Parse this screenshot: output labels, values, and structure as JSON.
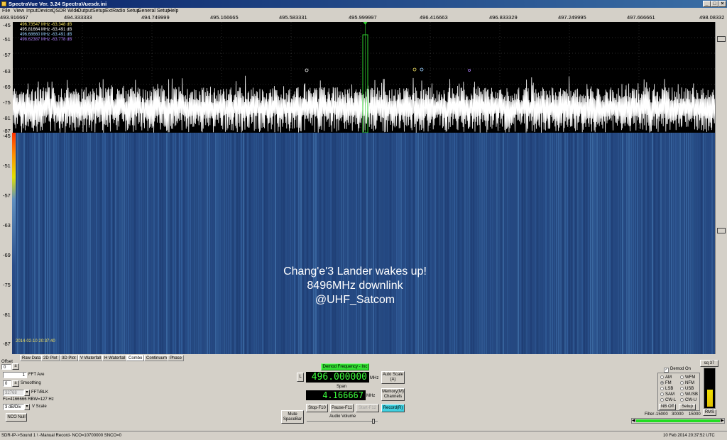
{
  "window": {
    "title": "SpectraVue Ver. 3.24  SpectraVuesdr.ini"
  },
  "menu": [
    "File",
    "View",
    "InputDevice",
    "QSDR Wide",
    "OutputSetup",
    "ExtRadio Setup",
    "General Setup",
    "Help"
  ],
  "spectrum": {
    "freq_ticks": [
      "493.916667",
      "494.333333",
      "494.749999",
      "495.166665",
      "495.583331",
      "495.999997",
      "496.416663",
      "496.833329",
      "497.249995",
      "497.666661",
      "498.08332"
    ],
    "db_ticks": [
      "-45",
      "-51",
      "-57",
      "-63",
      "-69",
      "-75",
      "-81",
      "-87"
    ],
    "markers": [
      {
        "text": "496.73547 MHz  -63.348 dB",
        "color": "#f0e060"
      },
      {
        "text": "495.81664 MHz  -63.491 dB",
        "color": "#ffffff"
      },
      {
        "text": "496.68660 MHz  -63.491 dB",
        "color": "#9ad0ff"
      },
      {
        "text": "498.62387 MHz  -63.778 dB",
        "color": "#b080ff"
      }
    ]
  },
  "waterfall": {
    "db_ticks": [
      "-45",
      "-51",
      "-57",
      "-63",
      "-69",
      "-75",
      "-81",
      "-87"
    ],
    "overlay_line1": "Chang'e'3 Lander wakes up!",
    "overlay_line2": "8496MHz downlink",
    "overlay_line3": "@UHF_Satcom",
    "timestamp": "2014-02-10  20:37:40"
  },
  "tabs": [
    "Raw Data",
    "2D Plot",
    "3D Plot",
    "V Waterfall",
    "H Waterfall",
    "Combo",
    "Continuum",
    "Phase"
  ],
  "active_tab": "Combo",
  "left_controls": {
    "offset_label": "Offset",
    "offset_value": "0",
    "fft_ave_value": "1",
    "fft_ave_label": "FFT Ave",
    "smoothing_value": "0",
    "smoothing_label": "Smoothing",
    "fft_blk_value": "32768",
    "fft_blk_label": "FFT/BLK",
    "fs_text": "Fs=4166666 RBW=127 Hz",
    "vscale_value": "3 dB/Div",
    "vscale_label": "V Scale",
    "nco_null": "NCO Null"
  },
  "center_controls": {
    "demod_freq_label": "Demod Frequency - Inc",
    "l_button": "L",
    "center_freq": "496.000000",
    "freq_unit": "MHz",
    "span_label": "Span",
    "span_value": "4.166667",
    "span_unit": "MHz",
    "auto_scale_line1": "Auto Scale",
    "auto_scale_line2": "(A)",
    "memory_line1": "Memory(M)",
    "memory_line2": "Channels",
    "mute_line1": "Mute",
    "mute_line2": "SpaceBar",
    "stop": "Stop-F10",
    "pause": "Pause-F11",
    "start": "Start-F12",
    "record": "Record(R)",
    "audio_volume": "Audio Volume"
  },
  "right_controls": {
    "sq_button": "sq 37",
    "demod_on_label": "Demod On",
    "modes_left": [
      "AM",
      "FM",
      "LSB",
      "SAM",
      "CW-L"
    ],
    "modes_right": [
      "WFM",
      "NFM",
      "USB",
      "WUSB",
      "CW-U"
    ],
    "selected_mode": "FM",
    "nb_off": "NB Off",
    "setup": "Setup",
    "rms": "RMS",
    "filter_label": "Filter",
    "filter_ticks": [
      "-15000",
      "30000",
      "15000"
    ]
  },
  "statusbar": {
    "left": "SDR-IP->Sound 1  \\ -Manual Record-   NCO=10700000  SNCO=0",
    "right": "10 Feb 2014   20:37:52 UTC"
  },
  "colors": {
    "spectrum_bg": "#000000",
    "waterfall_bg": "#24477f",
    "lcd_text": "#3cff3c",
    "demod_label_bg": "#33dd33",
    "record_bg": "#40d0e0",
    "filter_bar": "#22dd22"
  }
}
